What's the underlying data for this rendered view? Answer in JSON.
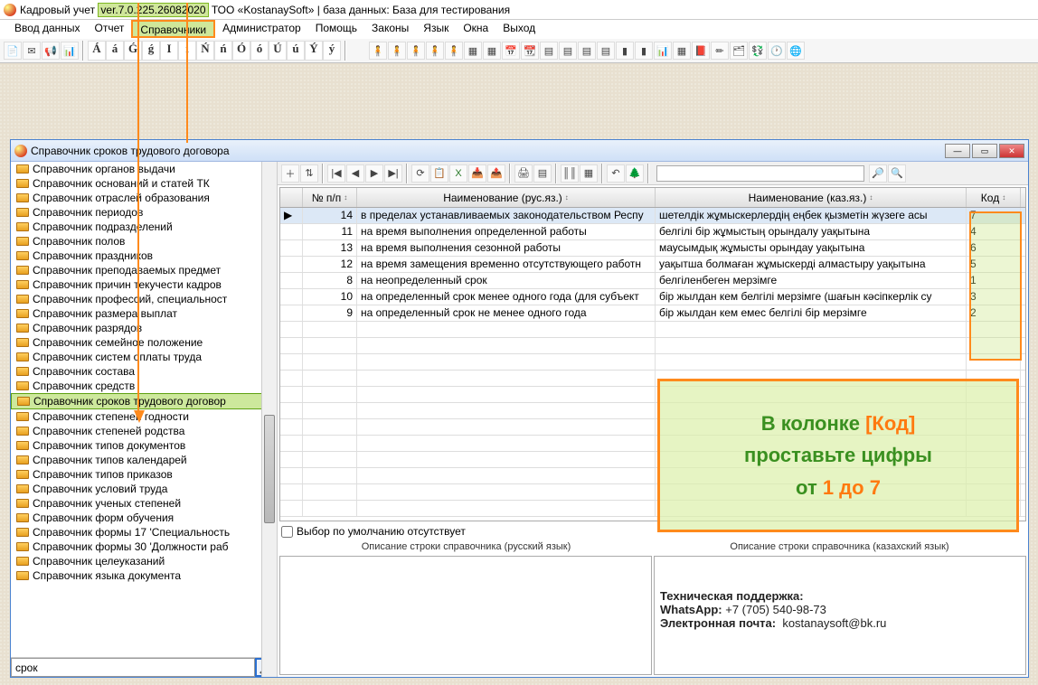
{
  "title_prefix": "Кадровый учет",
  "version": "ver.7.0.225.26082020",
  "title_suffix": "ТОО «KostanaySoft» | база данных: База для тестирования",
  "menu": [
    "Ввод данных",
    "Отчет",
    "Справочники",
    "Администратор",
    "Помощь",
    "Законы",
    "Язык",
    "Окна",
    "Выход"
  ],
  "chars": [
    "Á",
    "á",
    "Ǵ",
    "ǵ",
    "I",
    "ı",
    "Ń",
    "ń",
    "Ó",
    "ó",
    "Ú",
    "ú",
    "Ý",
    "ý"
  ],
  "child_title": "Справочник сроков трудового договора",
  "tree_items": [
    "Справочник органов выдачи",
    "Справочник оснований и статей ТК",
    "Справочник отраслей образования",
    "Справочник периодов",
    "Справочник подразделений",
    "Справочник полов",
    "Справочник праздников",
    "Справочник преподаваемых предмет",
    "Справочник причин текучести кадров",
    "Справочник профессий, специальност",
    "Справочник размера выплат",
    "Справочник разрядов",
    "Справочник семейное положение",
    "Справочник систем оплаты труда",
    "Справочник состава",
    "Справочник средств",
    "Справочник сроков трудового договор",
    "Справочник степеней годности",
    "Справочник степеней родства",
    "Справочник типов документов",
    "Справочник типов календарей",
    "Справочник типов приказов",
    "Справочник условий труда",
    "Справочник ученых степеней",
    "Справочник форм обучения",
    "Справочник формы 17 'Специальность",
    "Справочник формы 30 'Должности раб",
    "Справочник целеуказаний",
    "Справочник языка документа"
  ],
  "highlighted_index": 16,
  "search_value": "срок",
  "grid": {
    "col_num": "№ п/п",
    "col_rus": "Наименование (рус.яз.)",
    "col_kaz": "Наименование (каз.яз.)",
    "col_code": "Код",
    "rows": [
      {
        "n": 14,
        "rus": "в пределах устанавливаемых законодательством Респу",
        "kaz": "шетелдік жұмыскерлердің еңбек қызметін жүзеге асы",
        "code": 7
      },
      {
        "n": 11,
        "rus": "на время выполнения определенной работы",
        "kaz": "белгілі бір жұмыстың орындалу уақытына",
        "code": 4
      },
      {
        "n": 13,
        "rus": "на время выполнения сезонной работы",
        "kaz": "маусымдық жұмысты орындау уақытына",
        "code": 6
      },
      {
        "n": 12,
        "rus": "на время замещения временно отсутствующего работн",
        "kaz": "уақытша болмаған жұмыскерді алмастыру уақытына",
        "code": 5
      },
      {
        "n": 8,
        "rus": "на неопределенный срок",
        "kaz": "белгіленбеген мерзімге",
        "code": 1
      },
      {
        "n": 10,
        "rus": "на определенный срок менее одного года (для субъект",
        "kaz": "бір жылдан кем белгілі мерзімге (шағын кәсіпкерлік су",
        "code": 3
      },
      {
        "n": 9,
        "rus": "на определенный срок не менее одного года",
        "kaz": "бір жылдан кем емес белгілі бір мерзімге",
        "code": 2
      }
    ]
  },
  "default_choice": "Выбор по умолчанию отсутствует",
  "desc_rus_label": "Описание строки справочника (русский язык)",
  "desc_kaz_label": "Описание строки справочника (казахский язык)",
  "note_line1a": "В колонке ",
  "note_line1b": "[Код]",
  "note_line2": "проставьте цифры",
  "note_line3a": "от ",
  "note_line3b": "1 до 7",
  "support": {
    "title": "Техническая поддержка:",
    "whatsapp_label": "WhatsApp:",
    "whatsapp_value": "+7 (705) 540-98-73",
    "email_label": "Электронная почта:",
    "email_value": "kostanaysoft@bk.ru"
  }
}
